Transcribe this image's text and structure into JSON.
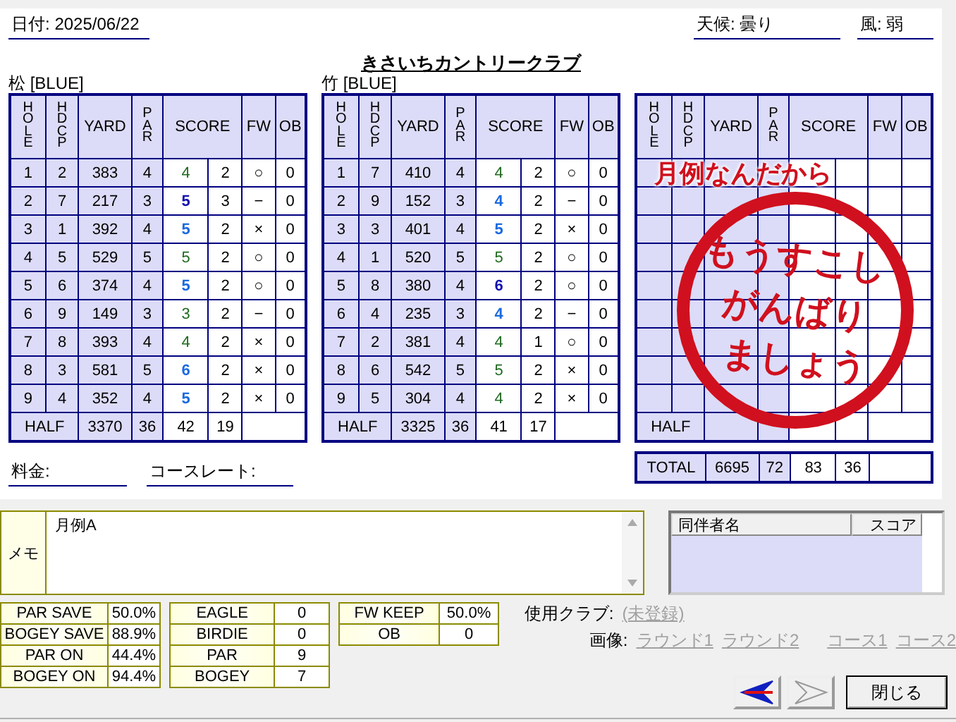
{
  "header": {
    "date_label": "日付:",
    "date": "2025/06/22",
    "title": "きさいちカントリークラブ",
    "weather_label": "天候:",
    "weather": "曇り",
    "wind_label": "風:",
    "wind": "弱"
  },
  "courses": [
    {
      "name": "松 [BLUE]",
      "columns": [
        "HOLE",
        "HDCP",
        "YARD",
        "PAR",
        "SCORE",
        "FW",
        "OB"
      ],
      "rows": [
        {
          "kind": "hole",
          "hole": "1",
          "hdcp": "2",
          "yard": "383",
          "par": "4",
          "score": "4",
          "putts": "2",
          "color": "#1e6a1e",
          "bold": false,
          "fw": "○",
          "ob": "0"
        },
        {
          "kind": "hole",
          "hole": "2",
          "hdcp": "7",
          "yard": "217",
          "par": "3",
          "score": "5",
          "putts": "3",
          "color": "#1010b0",
          "bold": true,
          "fw": "−",
          "ob": "0"
        },
        {
          "kind": "hole",
          "hole": "3",
          "hdcp": "1",
          "yard": "392",
          "par": "4",
          "score": "5",
          "putts": "2",
          "color": "#1a6ae0",
          "bold": true,
          "fw": "×",
          "ob": "0"
        },
        {
          "kind": "hole",
          "hole": "4",
          "hdcp": "5",
          "yard": "529",
          "par": "5",
          "score": "5",
          "putts": "2",
          "color": "#1e6a1e",
          "bold": false,
          "fw": "○",
          "ob": "0"
        },
        {
          "kind": "hole",
          "hole": "5",
          "hdcp": "6",
          "yard": "374",
          "par": "4",
          "score": "5",
          "putts": "2",
          "color": "#1a6ae0",
          "bold": true,
          "fw": "○",
          "ob": "0"
        },
        {
          "kind": "hole",
          "hole": "6",
          "hdcp": "9",
          "yard": "149",
          "par": "3",
          "score": "3",
          "putts": "2",
          "color": "#1e6a1e",
          "bold": false,
          "fw": "−",
          "ob": "0"
        },
        {
          "kind": "hole",
          "hole": "7",
          "hdcp": "8",
          "yard": "393",
          "par": "4",
          "score": "4",
          "putts": "2",
          "color": "#1e6a1e",
          "bold": false,
          "fw": "×",
          "ob": "0"
        },
        {
          "kind": "hole",
          "hole": "8",
          "hdcp": "3",
          "yard": "581",
          "par": "5",
          "score": "6",
          "putts": "2",
          "color": "#1a6ae0",
          "bold": true,
          "fw": "×",
          "ob": "0"
        },
        {
          "kind": "hole",
          "hole": "9",
          "hdcp": "4",
          "yard": "352",
          "par": "4",
          "score": "5",
          "putts": "2",
          "color": "#1a6ae0",
          "bold": true,
          "fw": "×",
          "ob": "0"
        }
      ],
      "half": {
        "label": "HALF",
        "yard": "3370",
        "par": "36",
        "score": "42",
        "putts": "19"
      }
    },
    {
      "name": "竹 [BLUE]",
      "columns": [
        "HOLE",
        "HDCP",
        "YARD",
        "PAR",
        "SCORE",
        "FW",
        "OB"
      ],
      "rows": [
        {
          "kind": "hole",
          "hole": "1",
          "hdcp": "7",
          "yard": "410",
          "par": "4",
          "score": "4",
          "putts": "2",
          "color": "#1e6a1e",
          "bold": false,
          "fw": "○",
          "ob": "0"
        },
        {
          "kind": "hole",
          "hole": "2",
          "hdcp": "9",
          "yard": "152",
          "par": "3",
          "score": "4",
          "putts": "2",
          "color": "#1a6ae0",
          "bold": true,
          "fw": "−",
          "ob": "0"
        },
        {
          "kind": "hole",
          "hole": "3",
          "hdcp": "3",
          "yard": "401",
          "par": "4",
          "score": "5",
          "putts": "2",
          "color": "#1a6ae0",
          "bold": true,
          "fw": "×",
          "ob": "0"
        },
        {
          "kind": "hole",
          "hole": "4",
          "hdcp": "1",
          "yard": "520",
          "par": "5",
          "score": "5",
          "putts": "2",
          "color": "#1e6a1e",
          "bold": false,
          "fw": "○",
          "ob": "0"
        },
        {
          "kind": "hole",
          "hole": "5",
          "hdcp": "8",
          "yard": "380",
          "par": "4",
          "score": "6",
          "putts": "2",
          "color": "#1010b0",
          "bold": true,
          "fw": "○",
          "ob": "0"
        },
        {
          "kind": "hole",
          "hole": "6",
          "hdcp": "4",
          "yard": "235",
          "par": "3",
          "score": "4",
          "putts": "2",
          "color": "#1a6ae0",
          "bold": true,
          "fw": "−",
          "ob": "0"
        },
        {
          "kind": "hole",
          "hole": "7",
          "hdcp": "2",
          "yard": "381",
          "par": "4",
          "score": "4",
          "putts": "1",
          "color": "#1e6a1e",
          "bold": false,
          "fw": "○",
          "ob": "0"
        },
        {
          "kind": "hole",
          "hole": "8",
          "hdcp": "6",
          "yard": "542",
          "par": "5",
          "score": "5",
          "putts": "2",
          "color": "#1e6a1e",
          "bold": false,
          "fw": "×",
          "ob": "0"
        },
        {
          "kind": "hole",
          "hole": "9",
          "hdcp": "5",
          "yard": "304",
          "par": "4",
          "score": "4",
          "putts": "2",
          "color": "#1e6a1e",
          "bold": false,
          "fw": "×",
          "ob": "0"
        }
      ],
      "half": {
        "label": "HALF",
        "yard": "3325",
        "par": "36",
        "score": "41",
        "putts": "17"
      }
    },
    {
      "columns": [
        "HOLE",
        "HDCP",
        "YARD",
        "PAR",
        "SCORE",
        "FW",
        "OB"
      ],
      "rows": [
        {
          "kind": "blank"
        },
        {
          "kind": "blank"
        },
        {
          "kind": "blank"
        },
        {
          "kind": "blank"
        },
        {
          "kind": "blank"
        },
        {
          "kind": "blank"
        },
        {
          "kind": "blank"
        },
        {
          "kind": "blank"
        },
        {
          "kind": "blank"
        }
      ],
      "half": {
        "label": "HALF"
      },
      "total": {
        "label": "TOTAL",
        "yard": "6695",
        "par": "72",
        "score": "83",
        "putts": "36"
      },
      "stamp": {
        "headline": "月例なんだから",
        "lines": [
          "もうすこし",
          "がんばり",
          "ましょう"
        ]
      }
    }
  ],
  "fee": {
    "label": "料金:"
  },
  "course_rate": {
    "label": "コースレート:"
  },
  "memo": {
    "label": "メモ",
    "value": "月例A"
  },
  "companions": {
    "columns": [
      "同伴者名",
      "スコア"
    ]
  },
  "stats": [
    [
      {
        "label": "PAR SAVE",
        "value": "50.0%"
      },
      {
        "label": "BOGEY SAVE",
        "value": "88.9%"
      },
      {
        "label": "PAR ON",
        "value": "44.4%"
      },
      {
        "label": "BOGEY ON",
        "value": "94.4%"
      }
    ],
    [
      {
        "label": "EAGLE",
        "value": "0"
      },
      {
        "label": "BIRDIE",
        "value": "0"
      },
      {
        "label": "PAR",
        "value": "9"
      },
      {
        "label": "BOGEY",
        "value": "7"
      }
    ],
    [
      {
        "label": "FW KEEP",
        "value": "50.0%"
      },
      {
        "label": "OB",
        "value": "0"
      }
    ]
  ],
  "club": {
    "label": "使用クラブ:",
    "link": {
      "text": "(未登録)",
      "disabled": true
    }
  },
  "images": {
    "label": "画像:",
    "links": [
      {
        "text": "ラウンド1",
        "disabled": true
      },
      {
        "text": "ラウンド2",
        "disabled": true
      },
      {
        "text": "コース1",
        "disabled": true
      },
      {
        "text": "コース2",
        "disabled": true
      }
    ]
  },
  "buttons": [
    {
      "kind": "prev",
      "disabled": false
    },
    {
      "kind": "next",
      "disabled": true
    },
    {
      "kind": "close",
      "label": "閉じる"
    }
  ]
}
